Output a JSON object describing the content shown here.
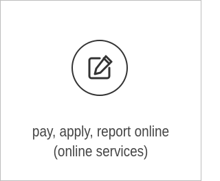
{
  "tile": {
    "icon": "edit-icon",
    "line1": "pay, apply, report online",
    "line2": "(online services)"
  },
  "colors": {
    "border": "#bdbdbd",
    "icon": "#333333",
    "text": "#444444"
  }
}
